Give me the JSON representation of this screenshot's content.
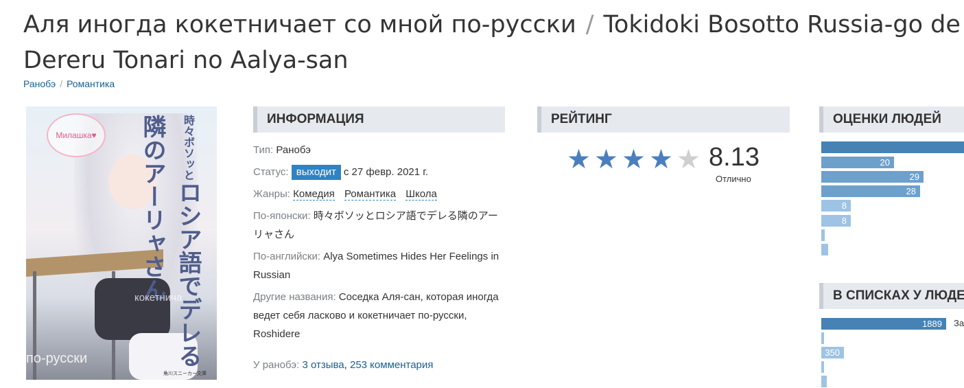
{
  "title": {
    "ru": "Аля иногда кокетничает со мной по-русски",
    "sep": "/",
    "romaji": "Tokidoki Bosotto Russia-go de Dereru Tonari no Aalya-san"
  },
  "breadcrumbs": [
    "Ранобэ",
    "Романтика"
  ],
  "breadcrumb_sep": "/",
  "cover": {
    "vertical_text": "ロシア語でデレる隣のアーリャさん",
    "top_text": "時々ボソッと",
    "badge": "Милашка♥",
    "watermark_1": "по-русски",
    "watermark_2": "кокетнича",
    "publisher": "角川スニーカー文庫"
  },
  "info": {
    "header": "ИНФОРМАЦИЯ",
    "type_label": "Тип:",
    "type_value": "Ранобэ",
    "status_label": "Статус:",
    "status_badge": "выходит",
    "status_date": "с 27 февр. 2021 г.",
    "genres_label": "Жанры:",
    "genres": [
      "Комедия",
      "Романтика",
      "Школа"
    ],
    "ja_label": "По-японски:",
    "ja_value": "時々ボソッとロシア語でデレる隣のアーリャさん",
    "en_label": "По-английски:",
    "en_value": "Alya Sometimes Hides Her Feelings in Russian",
    "other_label": "Другие названия:",
    "other_value": "Соседка Аля-сан, которая иногда ведет себя ласково и кокетничает по-русски, Roshidere",
    "footer_label": "У ранобэ:",
    "reviews": "3 отзыва",
    "comments": "253 комментария"
  },
  "rating": {
    "header": "РЕЙТИНГ",
    "score": "8.13",
    "label": "Отлично",
    "stars_filled": 4,
    "stars_total": 5
  },
  "people_scores": {
    "header": "ОЦЕНКИ ЛЮДЕЙ",
    "bars": [
      "",
      "20",
      "29",
      "28",
      "8",
      "8",
      "",
      ""
    ]
  },
  "lists": {
    "header": "В СПИСКАХ У ЛЮДЕЙ",
    "bars": [
      "1889",
      "",
      "350",
      "",
      ""
    ],
    "side_label": "За"
  },
  "colors": {
    "accent": "#4682b4",
    "link": "#176093",
    "status_badge": "#2f83c4",
    "header_bg": "#e6e9ee"
  }
}
